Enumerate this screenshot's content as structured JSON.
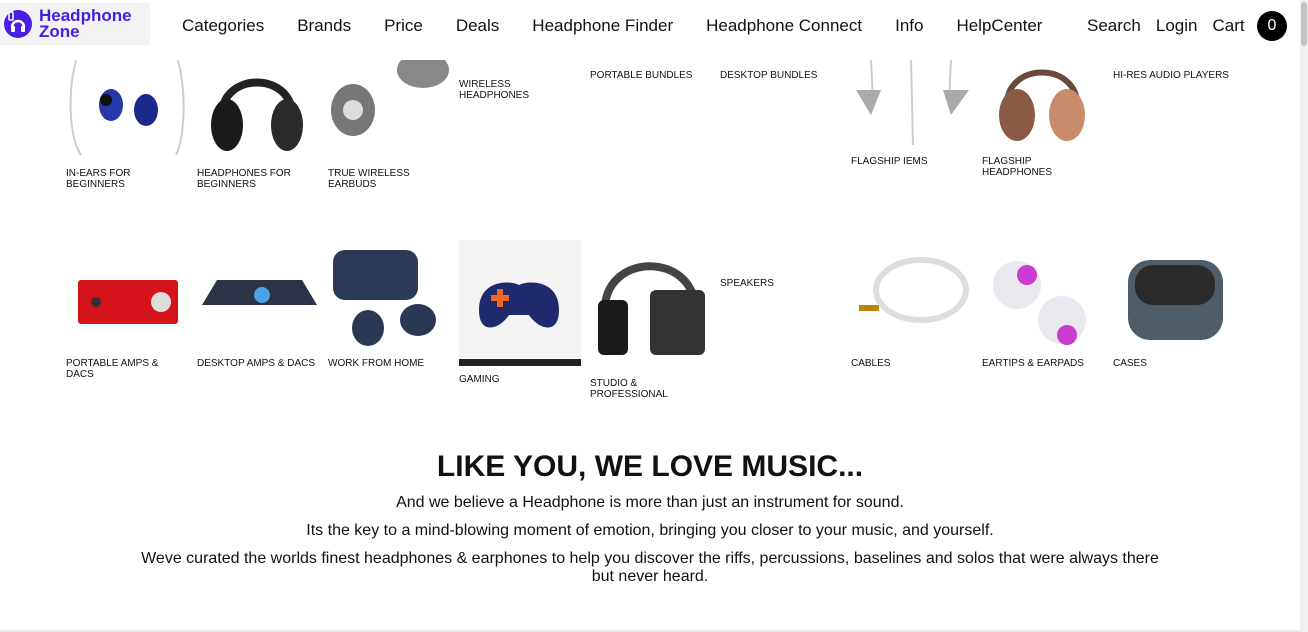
{
  "header": {
    "logo_text_1": "Headphone",
    "logo_text_2": "Zone",
    "nav": [
      "Categories",
      "Brands",
      "Price",
      "Deals",
      "Headphone Finder",
      "Headphone Connect",
      "Info",
      "HelpCenter"
    ],
    "search": "Search",
    "login": "Login",
    "cart": "Cart",
    "cart_count": "0"
  },
  "categories": {
    "row1": [
      "IN-EARS FOR BEGINNERS",
      "HEADPHONES FOR BEGINNERS",
      "TRUE WIRELESS EARBUDS",
      "WIRELESS HEADPHONES",
      "PORTABLE BUNDLES",
      "DESKTOP BUNDLES",
      "FLAGSHIP IEMS",
      "FLAGSHIP HEADPHONES",
      "HI-RES AUDIO PLAYERS"
    ],
    "row2": [
      "PORTABLE AMPS & DACS",
      "DESKTOP AMPS & DACS",
      "WORK FROM HOME",
      "GAMING",
      "STUDIO & PROFESSIONAL",
      "SPEAKERS",
      "CABLES",
      "EARTIPS & EARPADS",
      "CASES"
    ]
  },
  "intro": {
    "headline": "LIKE YOU, WE LOVE MUSIC...",
    "p1": "And we believe a Headphone is more than just an instrument for sound.",
    "p2": "Its the key to a mind-blowing moment of emotion, bringing you closer to your music, and yourself.",
    "p3": "Weve curated the worlds finest headphones & earphones to help you discover the riffs, percussions, baselines and solos that were always there but never heard."
  },
  "colors": {
    "brand": "#4a1ee0",
    "text": "#111111",
    "cart_badge": "#000000"
  }
}
